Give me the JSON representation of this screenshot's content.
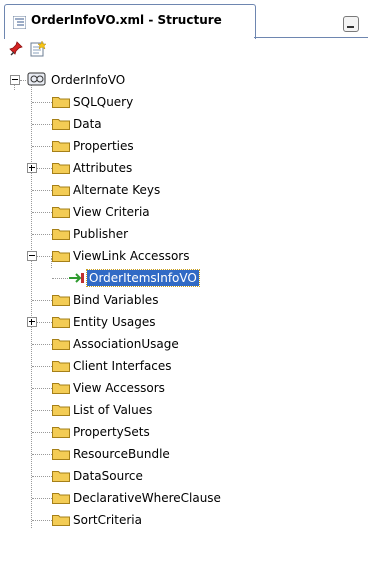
{
  "tab": {
    "title": "OrderInfoVO.xml - Structure"
  },
  "toolbar": {
    "pin_icon": "pin-icon",
    "new_icon": "new-item-icon"
  },
  "tree": {
    "root": "OrderInfoVO",
    "items": [
      {
        "label": "SQLQuery"
      },
      {
        "label": "Data"
      },
      {
        "label": "Properties"
      },
      {
        "label": "Attributes"
      },
      {
        "label": "Alternate Keys"
      },
      {
        "label": "View Criteria"
      },
      {
        "label": "Publisher"
      },
      {
        "label": "ViewLink Accessors"
      },
      {
        "label": "OrderItemsInfoVO"
      },
      {
        "label": "Bind Variables"
      },
      {
        "label": "Entity Usages"
      },
      {
        "label": "AssociationUsage"
      },
      {
        "label": "Client Interfaces"
      },
      {
        "label": "View Accessors"
      },
      {
        "label": "List of Values"
      },
      {
        "label": "PropertySets"
      },
      {
        "label": "ResourceBundle"
      },
      {
        "label": "DataSource"
      },
      {
        "label": "DeclarativeWhereClause"
      },
      {
        "label": "SortCriteria"
      }
    ]
  },
  "colors": {
    "selection": "#316ac5",
    "folder": "#f3cc55",
    "tab_border": "#6e86b0"
  }
}
